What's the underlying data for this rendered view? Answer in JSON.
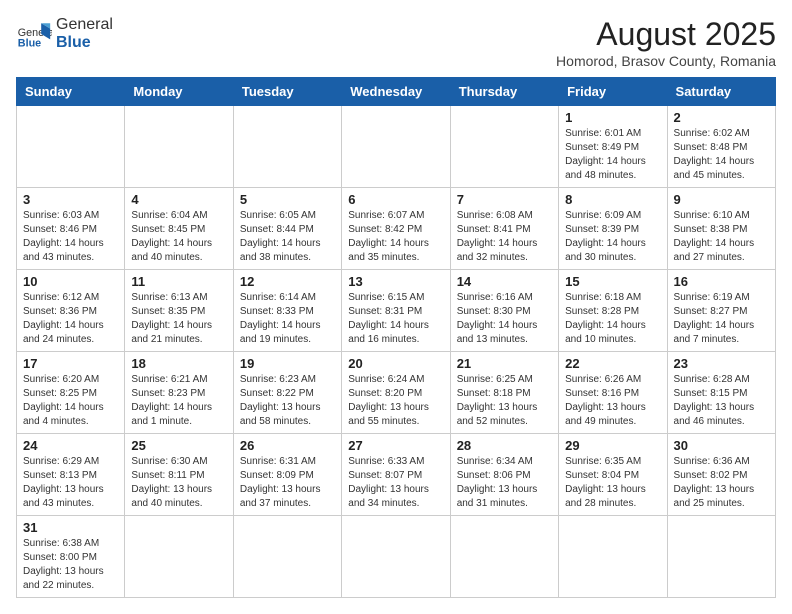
{
  "header": {
    "logo_general": "General",
    "logo_blue": "Blue",
    "month_year": "August 2025",
    "location": "Homorod, Brasov County, Romania"
  },
  "days_of_week": [
    "Sunday",
    "Monday",
    "Tuesday",
    "Wednesday",
    "Thursday",
    "Friday",
    "Saturday"
  ],
  "weeks": [
    [
      {
        "day": "",
        "info": ""
      },
      {
        "day": "",
        "info": ""
      },
      {
        "day": "",
        "info": ""
      },
      {
        "day": "",
        "info": ""
      },
      {
        "day": "",
        "info": ""
      },
      {
        "day": "1",
        "info": "Sunrise: 6:01 AM\nSunset: 8:49 PM\nDaylight: 14 hours and 48 minutes."
      },
      {
        "day": "2",
        "info": "Sunrise: 6:02 AM\nSunset: 8:48 PM\nDaylight: 14 hours and 45 minutes."
      }
    ],
    [
      {
        "day": "3",
        "info": "Sunrise: 6:03 AM\nSunset: 8:46 PM\nDaylight: 14 hours and 43 minutes."
      },
      {
        "day": "4",
        "info": "Sunrise: 6:04 AM\nSunset: 8:45 PM\nDaylight: 14 hours and 40 minutes."
      },
      {
        "day": "5",
        "info": "Sunrise: 6:05 AM\nSunset: 8:44 PM\nDaylight: 14 hours and 38 minutes."
      },
      {
        "day": "6",
        "info": "Sunrise: 6:07 AM\nSunset: 8:42 PM\nDaylight: 14 hours and 35 minutes."
      },
      {
        "day": "7",
        "info": "Sunrise: 6:08 AM\nSunset: 8:41 PM\nDaylight: 14 hours and 32 minutes."
      },
      {
        "day": "8",
        "info": "Sunrise: 6:09 AM\nSunset: 8:39 PM\nDaylight: 14 hours and 30 minutes."
      },
      {
        "day": "9",
        "info": "Sunrise: 6:10 AM\nSunset: 8:38 PM\nDaylight: 14 hours and 27 minutes."
      }
    ],
    [
      {
        "day": "10",
        "info": "Sunrise: 6:12 AM\nSunset: 8:36 PM\nDaylight: 14 hours and 24 minutes."
      },
      {
        "day": "11",
        "info": "Sunrise: 6:13 AM\nSunset: 8:35 PM\nDaylight: 14 hours and 21 minutes."
      },
      {
        "day": "12",
        "info": "Sunrise: 6:14 AM\nSunset: 8:33 PM\nDaylight: 14 hours and 19 minutes."
      },
      {
        "day": "13",
        "info": "Sunrise: 6:15 AM\nSunset: 8:31 PM\nDaylight: 14 hours and 16 minutes."
      },
      {
        "day": "14",
        "info": "Sunrise: 6:16 AM\nSunset: 8:30 PM\nDaylight: 14 hours and 13 minutes."
      },
      {
        "day": "15",
        "info": "Sunrise: 6:18 AM\nSunset: 8:28 PM\nDaylight: 14 hours and 10 minutes."
      },
      {
        "day": "16",
        "info": "Sunrise: 6:19 AM\nSunset: 8:27 PM\nDaylight: 14 hours and 7 minutes."
      }
    ],
    [
      {
        "day": "17",
        "info": "Sunrise: 6:20 AM\nSunset: 8:25 PM\nDaylight: 14 hours and 4 minutes."
      },
      {
        "day": "18",
        "info": "Sunrise: 6:21 AM\nSunset: 8:23 PM\nDaylight: 14 hours and 1 minute."
      },
      {
        "day": "19",
        "info": "Sunrise: 6:23 AM\nSunset: 8:22 PM\nDaylight: 13 hours and 58 minutes."
      },
      {
        "day": "20",
        "info": "Sunrise: 6:24 AM\nSunset: 8:20 PM\nDaylight: 13 hours and 55 minutes."
      },
      {
        "day": "21",
        "info": "Sunrise: 6:25 AM\nSunset: 8:18 PM\nDaylight: 13 hours and 52 minutes."
      },
      {
        "day": "22",
        "info": "Sunrise: 6:26 AM\nSunset: 8:16 PM\nDaylight: 13 hours and 49 minutes."
      },
      {
        "day": "23",
        "info": "Sunrise: 6:28 AM\nSunset: 8:15 PM\nDaylight: 13 hours and 46 minutes."
      }
    ],
    [
      {
        "day": "24",
        "info": "Sunrise: 6:29 AM\nSunset: 8:13 PM\nDaylight: 13 hours and 43 minutes."
      },
      {
        "day": "25",
        "info": "Sunrise: 6:30 AM\nSunset: 8:11 PM\nDaylight: 13 hours and 40 minutes."
      },
      {
        "day": "26",
        "info": "Sunrise: 6:31 AM\nSunset: 8:09 PM\nDaylight: 13 hours and 37 minutes."
      },
      {
        "day": "27",
        "info": "Sunrise: 6:33 AM\nSunset: 8:07 PM\nDaylight: 13 hours and 34 minutes."
      },
      {
        "day": "28",
        "info": "Sunrise: 6:34 AM\nSunset: 8:06 PM\nDaylight: 13 hours and 31 minutes."
      },
      {
        "day": "29",
        "info": "Sunrise: 6:35 AM\nSunset: 8:04 PM\nDaylight: 13 hours and 28 minutes."
      },
      {
        "day": "30",
        "info": "Sunrise: 6:36 AM\nSunset: 8:02 PM\nDaylight: 13 hours and 25 minutes."
      }
    ],
    [
      {
        "day": "31",
        "info": "Sunrise: 6:38 AM\nSunset: 8:00 PM\nDaylight: 13 hours and 22 minutes."
      },
      {
        "day": "",
        "info": ""
      },
      {
        "day": "",
        "info": ""
      },
      {
        "day": "",
        "info": ""
      },
      {
        "day": "",
        "info": ""
      },
      {
        "day": "",
        "info": ""
      },
      {
        "day": "",
        "info": ""
      }
    ]
  ]
}
